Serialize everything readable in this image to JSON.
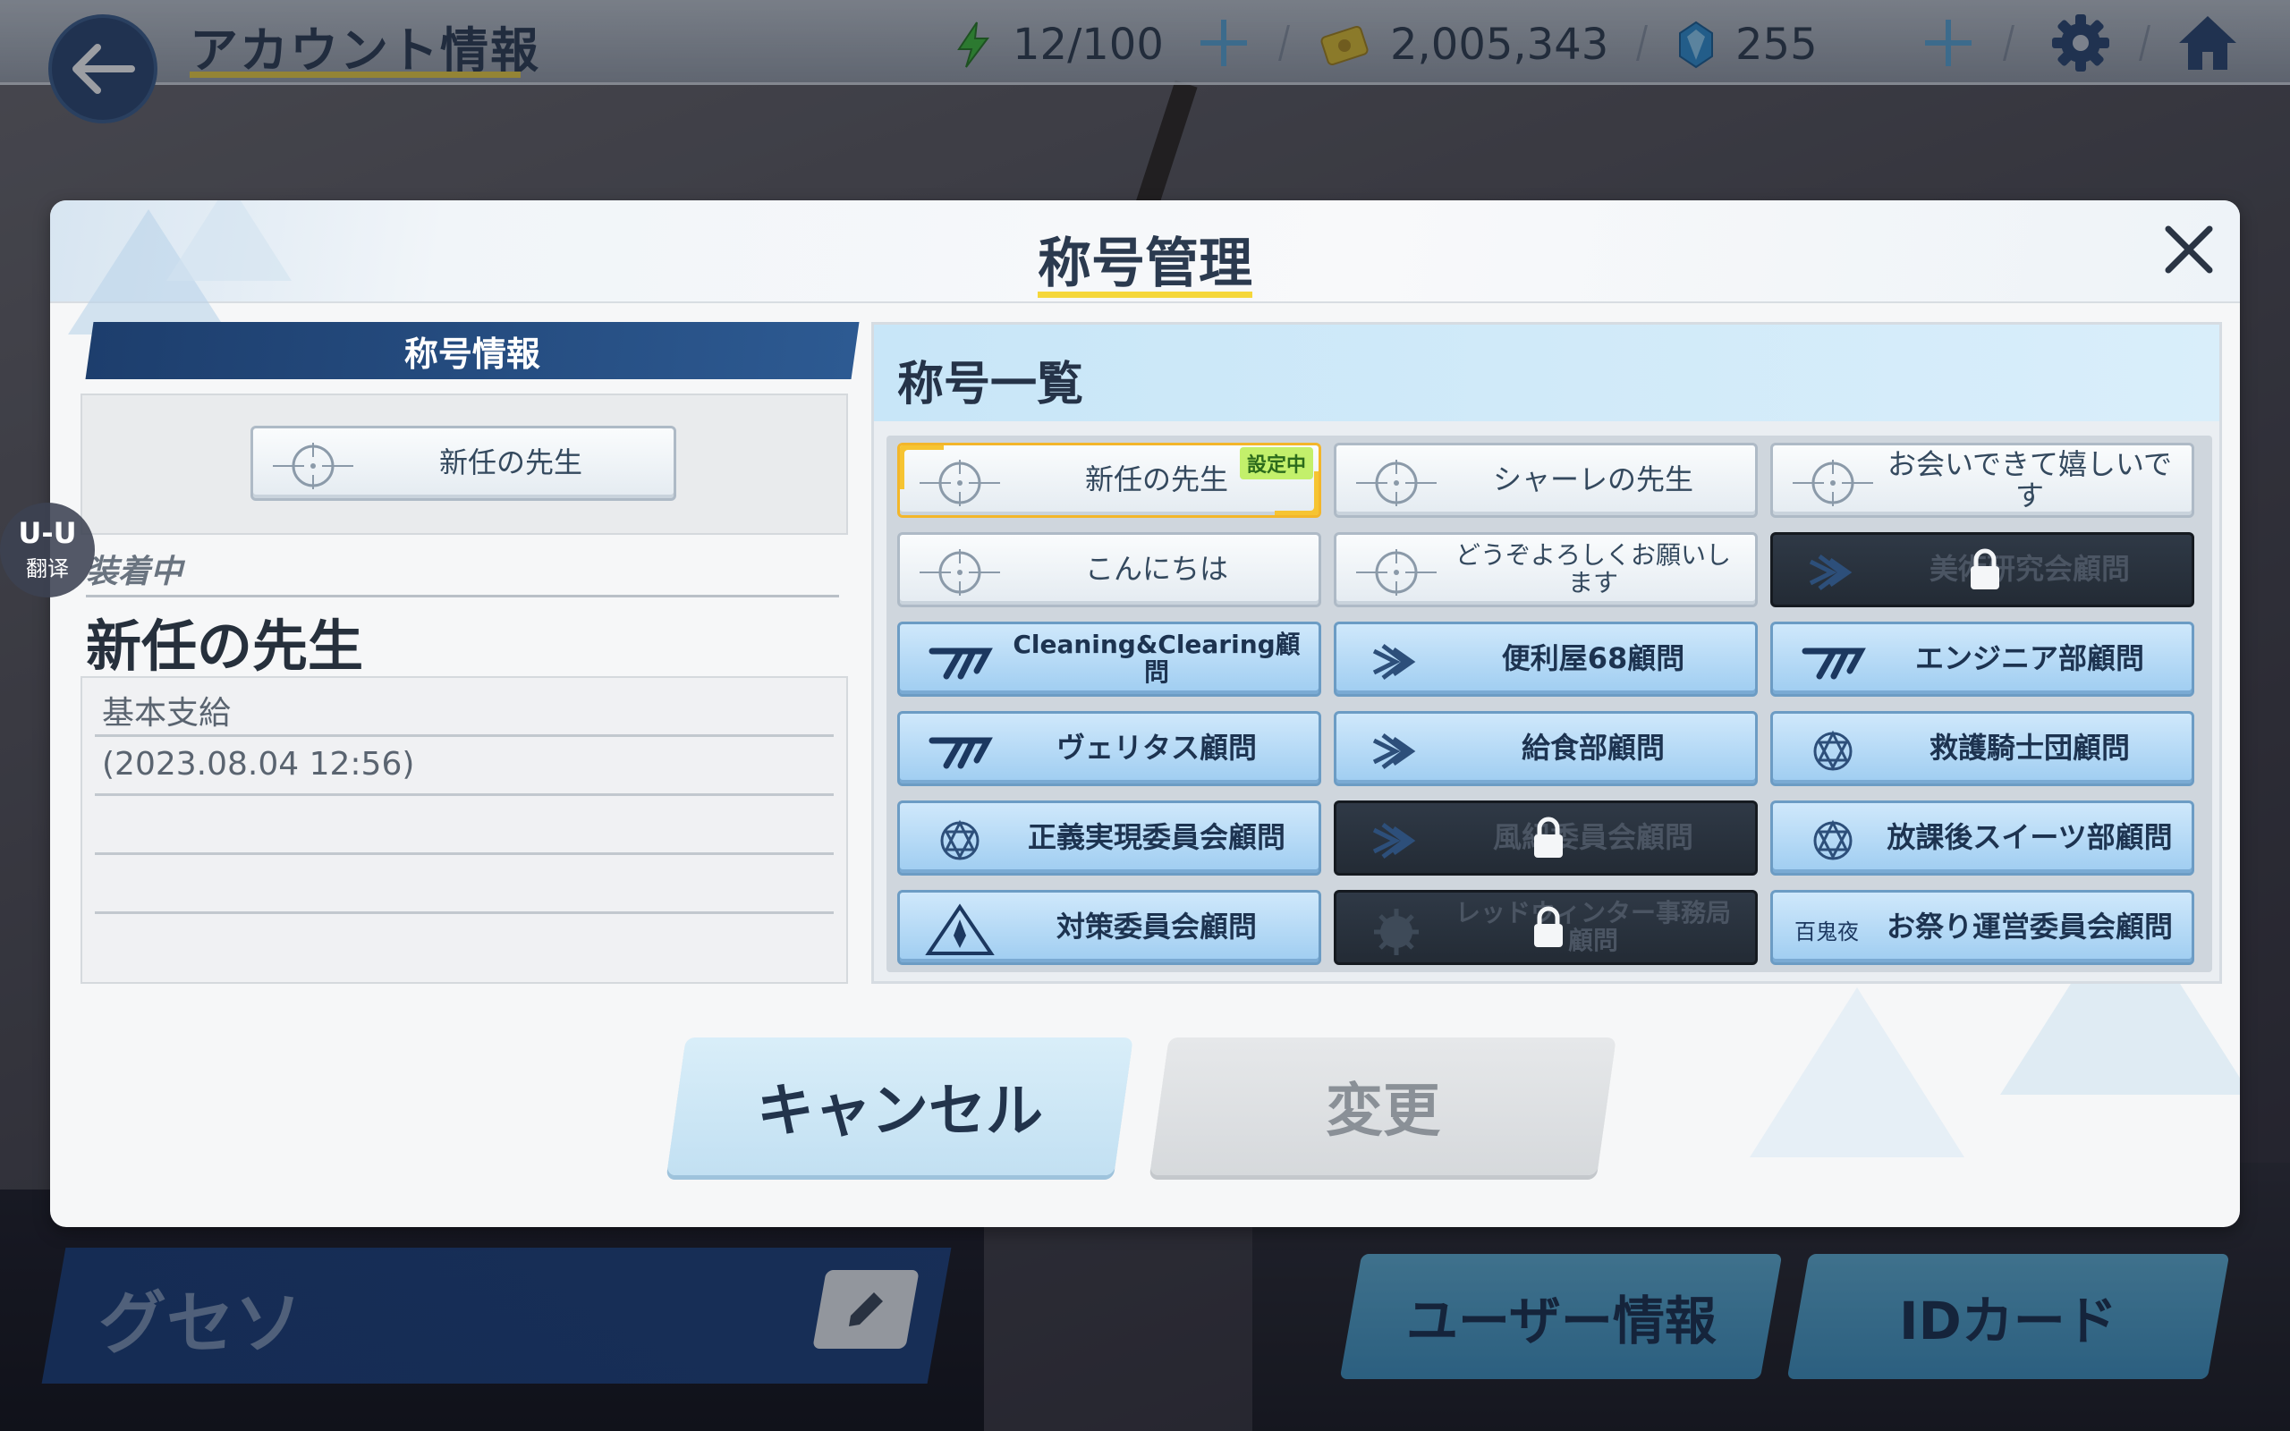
{
  "topbar": {
    "title": "アカウント情報",
    "ap": "12/100",
    "credits": "2,005,343",
    "pyroxene": "255"
  },
  "modal": {
    "title": "称号管理",
    "info": {
      "header": "称号情報",
      "preview_title": "新任の先生",
      "equipped_label": "装着中",
      "equipped_name": "新任の先生",
      "detail_lines": [
        "基本支給",
        "(2023.08.04 12:56)",
        "",
        ""
      ]
    },
    "list": {
      "header": "称号一覧",
      "active_badge": "設定中",
      "items": [
        {
          "label": "新任の先生",
          "style": "white",
          "icon": "crosshair-icon",
          "locked": false,
          "selected": true
        },
        {
          "label": "シャーレの先生",
          "style": "white",
          "icon": "crosshair-icon",
          "locked": false,
          "selected": false
        },
        {
          "label": "お会いできて嬉しいです",
          "style": "white",
          "icon": "crosshair-icon",
          "locked": false,
          "selected": false
        },
        {
          "label": "こんにちは",
          "style": "white",
          "icon": "crosshair-icon",
          "locked": false,
          "selected": false
        },
        {
          "label": "どうぞよろしくお願いします",
          "style": "white",
          "icon": "crosshair-icon",
          "locked": false,
          "selected": false
        },
        {
          "label": "美術研究会顧問",
          "style": "dark",
          "icon": "wing-emblem-icon",
          "locked": true,
          "selected": false
        },
        {
          "label": "Cleaning&Clearing顧問",
          "style": "blue",
          "icon": "millennium-emblem-icon",
          "locked": false,
          "selected": false
        },
        {
          "label": "便利屋68顧問",
          "style": "blue",
          "icon": "wing-emblem-icon",
          "locked": false,
          "selected": false
        },
        {
          "label": "エンジニア部顧問",
          "style": "blue",
          "icon": "millennium-emblem-icon",
          "locked": false,
          "selected": false
        },
        {
          "label": "ヴェリタス顧問",
          "style": "blue",
          "icon": "millennium-emblem-icon",
          "locked": false,
          "selected": false
        },
        {
          "label": "給食部顧問",
          "style": "blue",
          "icon": "wing-emblem-icon",
          "locked": false,
          "selected": false
        },
        {
          "label": "救護騎士団顧問",
          "style": "blue",
          "icon": "trinity-emblem-icon",
          "locked": false,
          "selected": false
        },
        {
          "label": "正義実現委員会顧問",
          "style": "blue",
          "icon": "trinity-emblem-icon",
          "locked": false,
          "selected": false
        },
        {
          "label": "風紀委員会顧問",
          "style": "dark",
          "icon": "wing-emblem-icon",
          "locked": true,
          "selected": false
        },
        {
          "label": "放課後スイーツ部顧問",
          "style": "blue",
          "icon": "trinity-emblem-icon",
          "locked": false,
          "selected": false
        },
        {
          "label": "対策委員会顧問",
          "style": "blue",
          "icon": "abydos-emblem-icon",
          "locked": false,
          "selected": false
        },
        {
          "label": "レッドウィンター事務局顧問",
          "style": "dark",
          "icon": "redwinter-emblem-icon",
          "locked": true,
          "selected": false
        },
        {
          "label": "お祭り運営委員会顧問",
          "style": "blue",
          "icon": "hyakkiyako-emblem-icon",
          "locked": false,
          "selected": false
        }
      ]
    },
    "buttons": {
      "cancel": "キャンセル",
      "change": "変更"
    }
  },
  "bottom": {
    "player_name": "グセソ",
    "user_info": "ユーザー情報",
    "id_card": "IDカード"
  },
  "overlay": {
    "translate_logo": "U-U",
    "translate_label": "翻译"
  },
  "colors": {
    "accent_yellow": "#f5d73a",
    "header_blue": "#1d3e6d",
    "chip_blue": "#9fcdf1",
    "locked": "#232b35"
  }
}
